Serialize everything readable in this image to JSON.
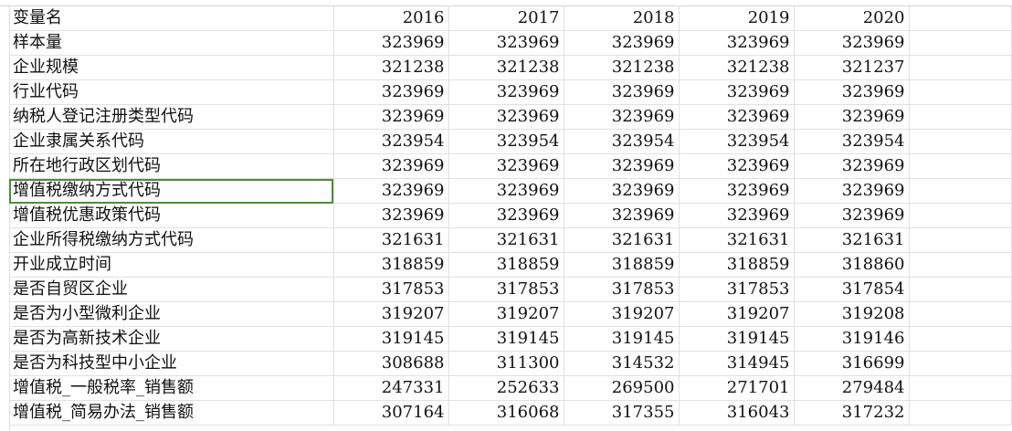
{
  "sheet": {
    "header": {
      "name": "变量名",
      "years": [
        "2016",
        "2017",
        "2018",
        "2019",
        "2020"
      ]
    },
    "rows": [
      {
        "name": "样本量",
        "values": [
          "323969",
          "323969",
          "323969",
          "323969",
          "323969"
        ]
      },
      {
        "name": "企业规模",
        "values": [
          "321238",
          "321238",
          "321238",
          "321238",
          "321237"
        ]
      },
      {
        "name": "行业代码",
        "values": [
          "323969",
          "323969",
          "323969",
          "323969",
          "323969"
        ]
      },
      {
        "name": "纳税人登记注册类型代码",
        "values": [
          "323969",
          "323969",
          "323969",
          "323969",
          "323969"
        ]
      },
      {
        "name": "企业隶属关系代码",
        "values": [
          "323954",
          "323954",
          "323954",
          "323954",
          "323954"
        ]
      },
      {
        "name": "所在地行政区划代码",
        "values": [
          "323969",
          "323969",
          "323969",
          "323969",
          "323969"
        ]
      },
      {
        "name": "增值税缴纳方式代码",
        "values": [
          "323969",
          "323969",
          "323969",
          "323969",
          "323969"
        ]
      },
      {
        "name": "增值税优惠政策代码",
        "values": [
          "323969",
          "323969",
          "323969",
          "323969",
          "323969"
        ]
      },
      {
        "name": "企业所得税缴纳方式代码",
        "values": [
          "321631",
          "321631",
          "321631",
          "321631",
          "321631"
        ]
      },
      {
        "name": "开业成立时间",
        "values": [
          "318859",
          "318859",
          "318859",
          "318859",
          "318860"
        ]
      },
      {
        "name": "是否自贸区企业",
        "values": [
          "317853",
          "317853",
          "317853",
          "317853",
          "317854"
        ]
      },
      {
        "name": "是否为小型微利企业",
        "values": [
          "319207",
          "319207",
          "319207",
          "319207",
          "319208"
        ]
      },
      {
        "name": "是否为高新技术企业",
        "values": [
          "319145",
          "319145",
          "319145",
          "319145",
          "319146"
        ]
      },
      {
        "name": "是否为科技型中小企业",
        "values": [
          "308688",
          "311300",
          "314532",
          "314945",
          "316699"
        ]
      },
      {
        "name": "增值税_一般税率_销售额",
        "values": [
          "247331",
          "252633",
          "269500",
          "271701",
          "279484"
        ]
      },
      {
        "name": "增值税_简易办法_销售额",
        "values": [
          "307164",
          "316068",
          "317355",
          "316043",
          "317232"
        ]
      }
    ],
    "selected_cell": "增值税缴纳方式代码",
    "selection_color": "#4d8d3c"
  }
}
